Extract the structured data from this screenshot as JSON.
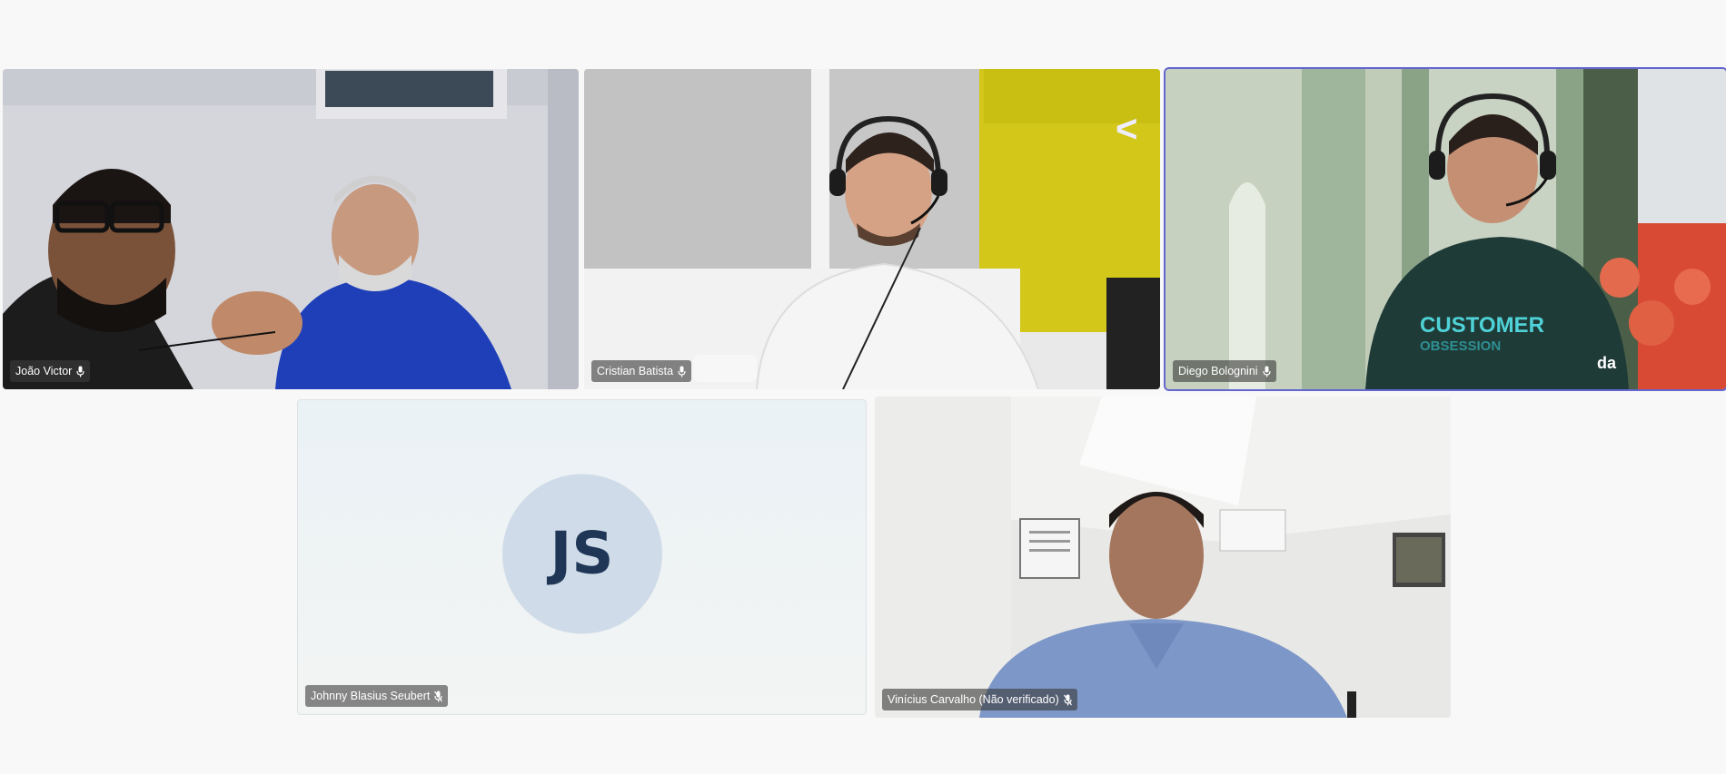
{
  "participants": [
    {
      "name": "João Victor",
      "mic": "mic-on",
      "video": true
    },
    {
      "name": "Cristian Batista",
      "mic": "mic-on",
      "video": true
    },
    {
      "name": "Diego Bolognini",
      "mic": "mic-on",
      "video": true,
      "active_speaker": true
    },
    {
      "name": "Johnny Blasius Seubert",
      "mic": "mic-off",
      "video": false,
      "initials": "JS"
    },
    {
      "name": "Vinícius Carvalho (Não verificado)",
      "mic": "mic-off",
      "video": true
    }
  ],
  "colors": {
    "background": "#f8f8f8",
    "active_speaker_border": "#6466d0",
    "avatar_bg": "#cfdbe8",
    "avatar_text": "#1f3656"
  },
  "icons": {
    "mic_on": "microphone-icon",
    "mic_off": "microphone-muted-icon"
  }
}
